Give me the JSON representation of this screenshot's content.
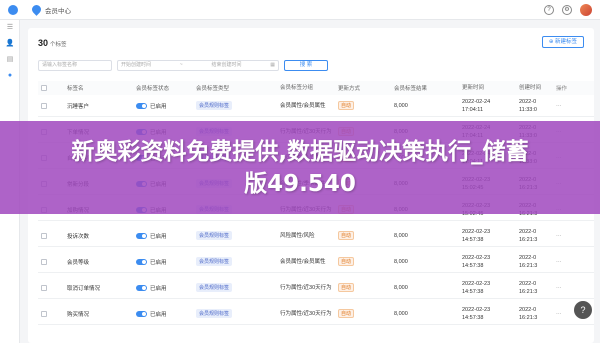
{
  "header": {
    "breadcrumb": "会员中心",
    "icons": [
      "logo-icon",
      "help-icon",
      "settings-icon",
      "avatar"
    ]
  },
  "rail": {
    "icons": [
      "menu-icon",
      "user-icon",
      "group-icon",
      "tag-icon"
    ]
  },
  "list": {
    "count": "30",
    "count_unit": "个标签",
    "new_button": "新建标签"
  },
  "filters": {
    "name_placeholder": "请输入标签名称",
    "start_placeholder": "开始创建时间",
    "date_separator": "~",
    "end_placeholder": "结束创建时间",
    "search_label": "搜 索"
  },
  "table": {
    "headers": [
      "标签名",
      "会员标签状态",
      "会员标签类型",
      "会员标签分组",
      "更新方式",
      "会员标签结果",
      "更新时间",
      "创建时间",
      "操作"
    ],
    "rows": [
      {
        "name": "沉睡客户",
        "status": "已启用",
        "type": "会员规则标签",
        "group": "会员属性/会员属性",
        "update": "自动",
        "result": "8,000",
        "time_date": "2022-02-24",
        "time_clock": "17:04:11",
        "ctime_date": "2022-0",
        "ctime_clock": "11:33:0"
      },
      {
        "name": "下单情况",
        "status": "已启用",
        "type": "会员规则标签",
        "group": "行为属性/近30天行为",
        "update": "自动",
        "result": "8,000",
        "time_date": "2022-02-24",
        "time_clock": "17:04:11",
        "ctime_date": "2022-0",
        "ctime_clock": "11:33:0"
      },
      {
        "name": "自然性别",
        "status": "已启用",
        "type": "会员规则标签",
        "group": "会员属性/会员属性",
        "update": "自动",
        "result": "8,000",
        "time_date": "2022-02-24",
        "time_clock": "17:04:11",
        "ctime_date": "2022-0",
        "ctime_clock": "11:33:0"
      },
      {
        "name": "常新分段",
        "status": "已启用",
        "type": "会员规则标签",
        "group": "会员属性/季卡属性",
        "update": "自动",
        "result": "8,000",
        "time_date": "2022-02-23",
        "time_clock": "15:02:45",
        "ctime_date": "2022-0",
        "ctime_clock": "16:21:3"
      },
      {
        "name": "加购情况",
        "status": "已启用",
        "type": "会员规则标签",
        "group": "行为属性/近30天行为",
        "update": "自动",
        "result": "8,000",
        "time_date": "2022-02-23",
        "time_clock": "15:02:45",
        "ctime_date": "2022-0",
        "ctime_clock": "16:21:3"
      },
      {
        "name": "投诉次数",
        "status": "已启用",
        "type": "会员规则标签",
        "group": "风险属性/风险",
        "update": "自动",
        "result": "8,000",
        "time_date": "2022-02-23",
        "time_clock": "14:57:38",
        "ctime_date": "2022-0",
        "ctime_clock": "16:21:3"
      },
      {
        "name": "会员等级",
        "status": "已启用",
        "type": "会员规则标签",
        "group": "会员属性/会员属性",
        "update": "自动",
        "result": "8,000",
        "time_date": "2022-02-23",
        "time_clock": "14:57:38",
        "ctime_date": "2022-0",
        "ctime_clock": "16:21:3"
      },
      {
        "name": "取消订单情况",
        "status": "已启用",
        "type": "会员规则标签",
        "group": "行为属性/近30天行为",
        "update": "自动",
        "result": "8,000",
        "time_date": "2022-02-23",
        "time_clock": "14:57:38",
        "ctime_date": "2022-0",
        "ctime_clock": "16:21:3"
      },
      {
        "name": "购买情况",
        "status": "已启用",
        "type": "会员规则标签",
        "group": "行为属性/近30天行为",
        "update": "自动",
        "result": "8,000",
        "time_date": "2022-02-23",
        "time_clock": "14:57:38",
        "ctime_date": "2022-0",
        "ctime_clock": "16:21:3"
      }
    ],
    "op_label": "···"
  },
  "banner": {
    "line1": "新奥彩资料免费提供,数据驱动决策执行_储蓄",
    "line2": "版49.540"
  },
  "fab": "?"
}
